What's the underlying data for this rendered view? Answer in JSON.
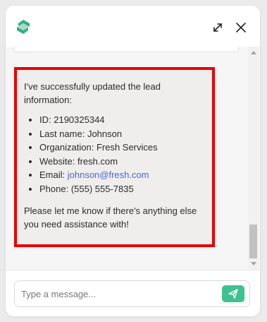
{
  "header": {
    "logo_icon": "brand-logo-icon",
    "expand_icon": "expand-icon",
    "close_icon": "close-icon"
  },
  "message": {
    "intro": "I've successfully updated the lead information:",
    "items": [
      {
        "label": "ID: ",
        "value": "2190325344"
      },
      {
        "label": "Last name: ",
        "value": "Johnson"
      },
      {
        "label": "Organization: ",
        "value": "Fresh Services"
      },
      {
        "label": "Website: ",
        "value": "fresh.com"
      },
      {
        "label": "Email: ",
        "value": "johnson@fresh.com"
      },
      {
        "label": "Phone: ",
        "value": "(555) 555-7835"
      }
    ],
    "closing": "Please let me know if there's anything else you need assistance with!"
  },
  "composer": {
    "placeholder": "Type a message...",
    "send_icon": "send-icon"
  },
  "colors": {
    "brand": "#2fb383",
    "send_button": "#3ec390",
    "highlight_border": "#e80000",
    "link": "#4a64e0",
    "bubble": "#efeeec"
  }
}
